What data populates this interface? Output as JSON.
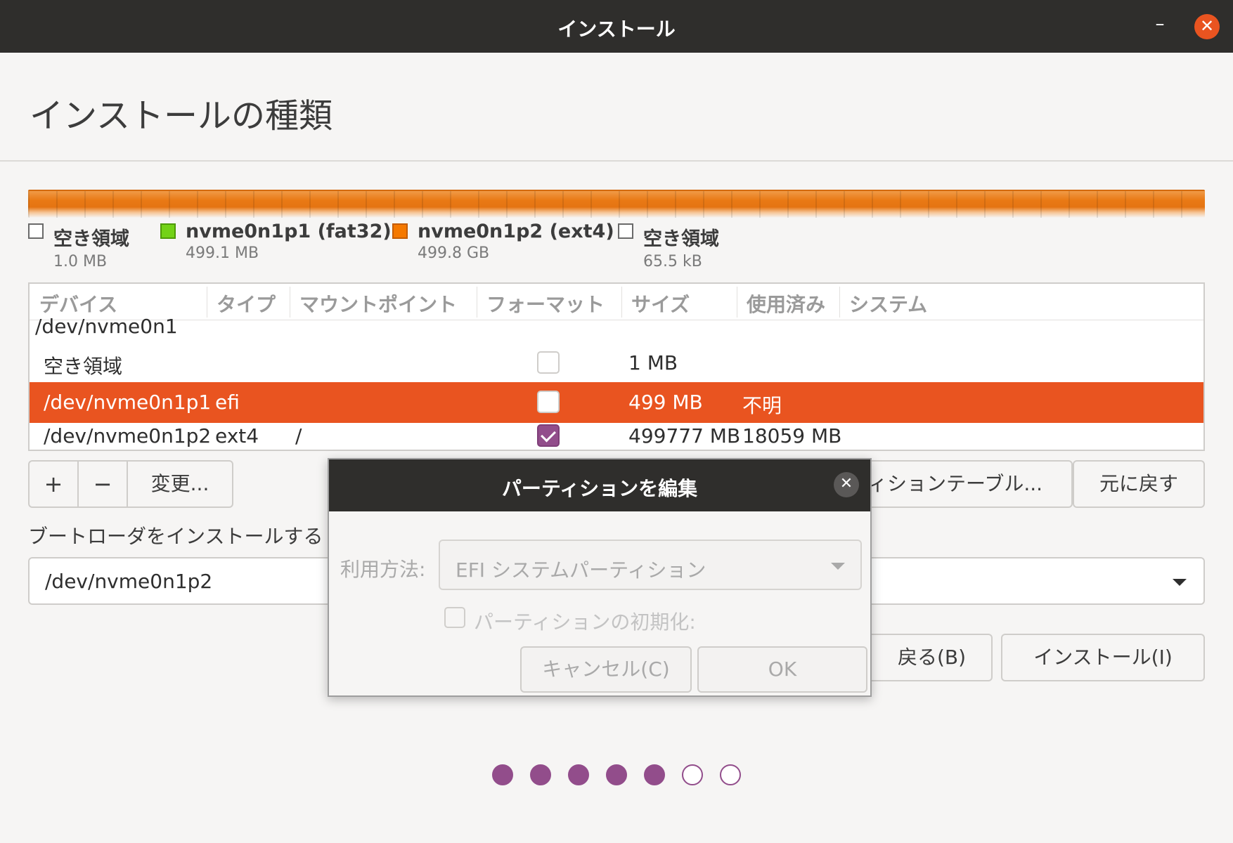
{
  "window": {
    "title": "インストール",
    "minimize_glyph": "–",
    "close_glyph": "✕"
  },
  "page": {
    "heading": "インストールの種類"
  },
  "legend": [
    {
      "name": "空き領域",
      "size": "1.0 MB",
      "color": "#ffffff"
    },
    {
      "name": "nvme0n1p1 (fat32)",
      "size": "499.1 MB",
      "color": "#73d216"
    },
    {
      "name": "nvme0n1p2 (ext4)",
      "size": "499.8 GB",
      "color": "#f57900"
    },
    {
      "name": "空き領域",
      "size": "65.5 kB",
      "color": "#ffffff"
    }
  ],
  "table": {
    "headers": [
      "デバイス",
      "タイプ",
      "マウントポイント",
      "フォーマット",
      "サイズ",
      "使用済み",
      "システム"
    ],
    "group": "/dev/nvme0n1",
    "rows": [
      {
        "device": "空き領域",
        "type": "",
        "mount": "",
        "format": false,
        "size": "1 MB",
        "used": "",
        "system": ""
      },
      {
        "device": "/dev/nvme0n1p1",
        "type": "efi",
        "mount": "",
        "format": false,
        "size": "499 MB",
        "used": "不明",
        "system": ""
      },
      {
        "device": "/dev/nvme0n1p2",
        "type": "ext4",
        "mount": "/",
        "format": true,
        "size": "499777 MB",
        "used": "18059 MB",
        "system": ""
      }
    ],
    "selected_row": 1
  },
  "toolbar": {
    "add": "+",
    "remove": "−",
    "change": "変更...",
    "new_table": "ィションテーブル...",
    "revert": "元に戻す"
  },
  "bootloader": {
    "label": "ブートローダをインストールする",
    "device": "/dev/nvme0n1p2"
  },
  "nav": {
    "back": "戻る(B)",
    "install": "インストール(I)"
  },
  "progress": {
    "total": 7,
    "completed": 5
  },
  "dialog": {
    "title": "パーティションを編集",
    "close_glyph": "✕",
    "use_as_label": "利用方法:",
    "use_as_value": "EFI システムパーティション",
    "format_label": "パーティションの初期化:",
    "cancel": "キャンセル(C)",
    "ok": "OK"
  },
  "colors": {
    "accent": "#e95420",
    "progress": "#924d8b",
    "titlebar": "#2f2e2c"
  }
}
